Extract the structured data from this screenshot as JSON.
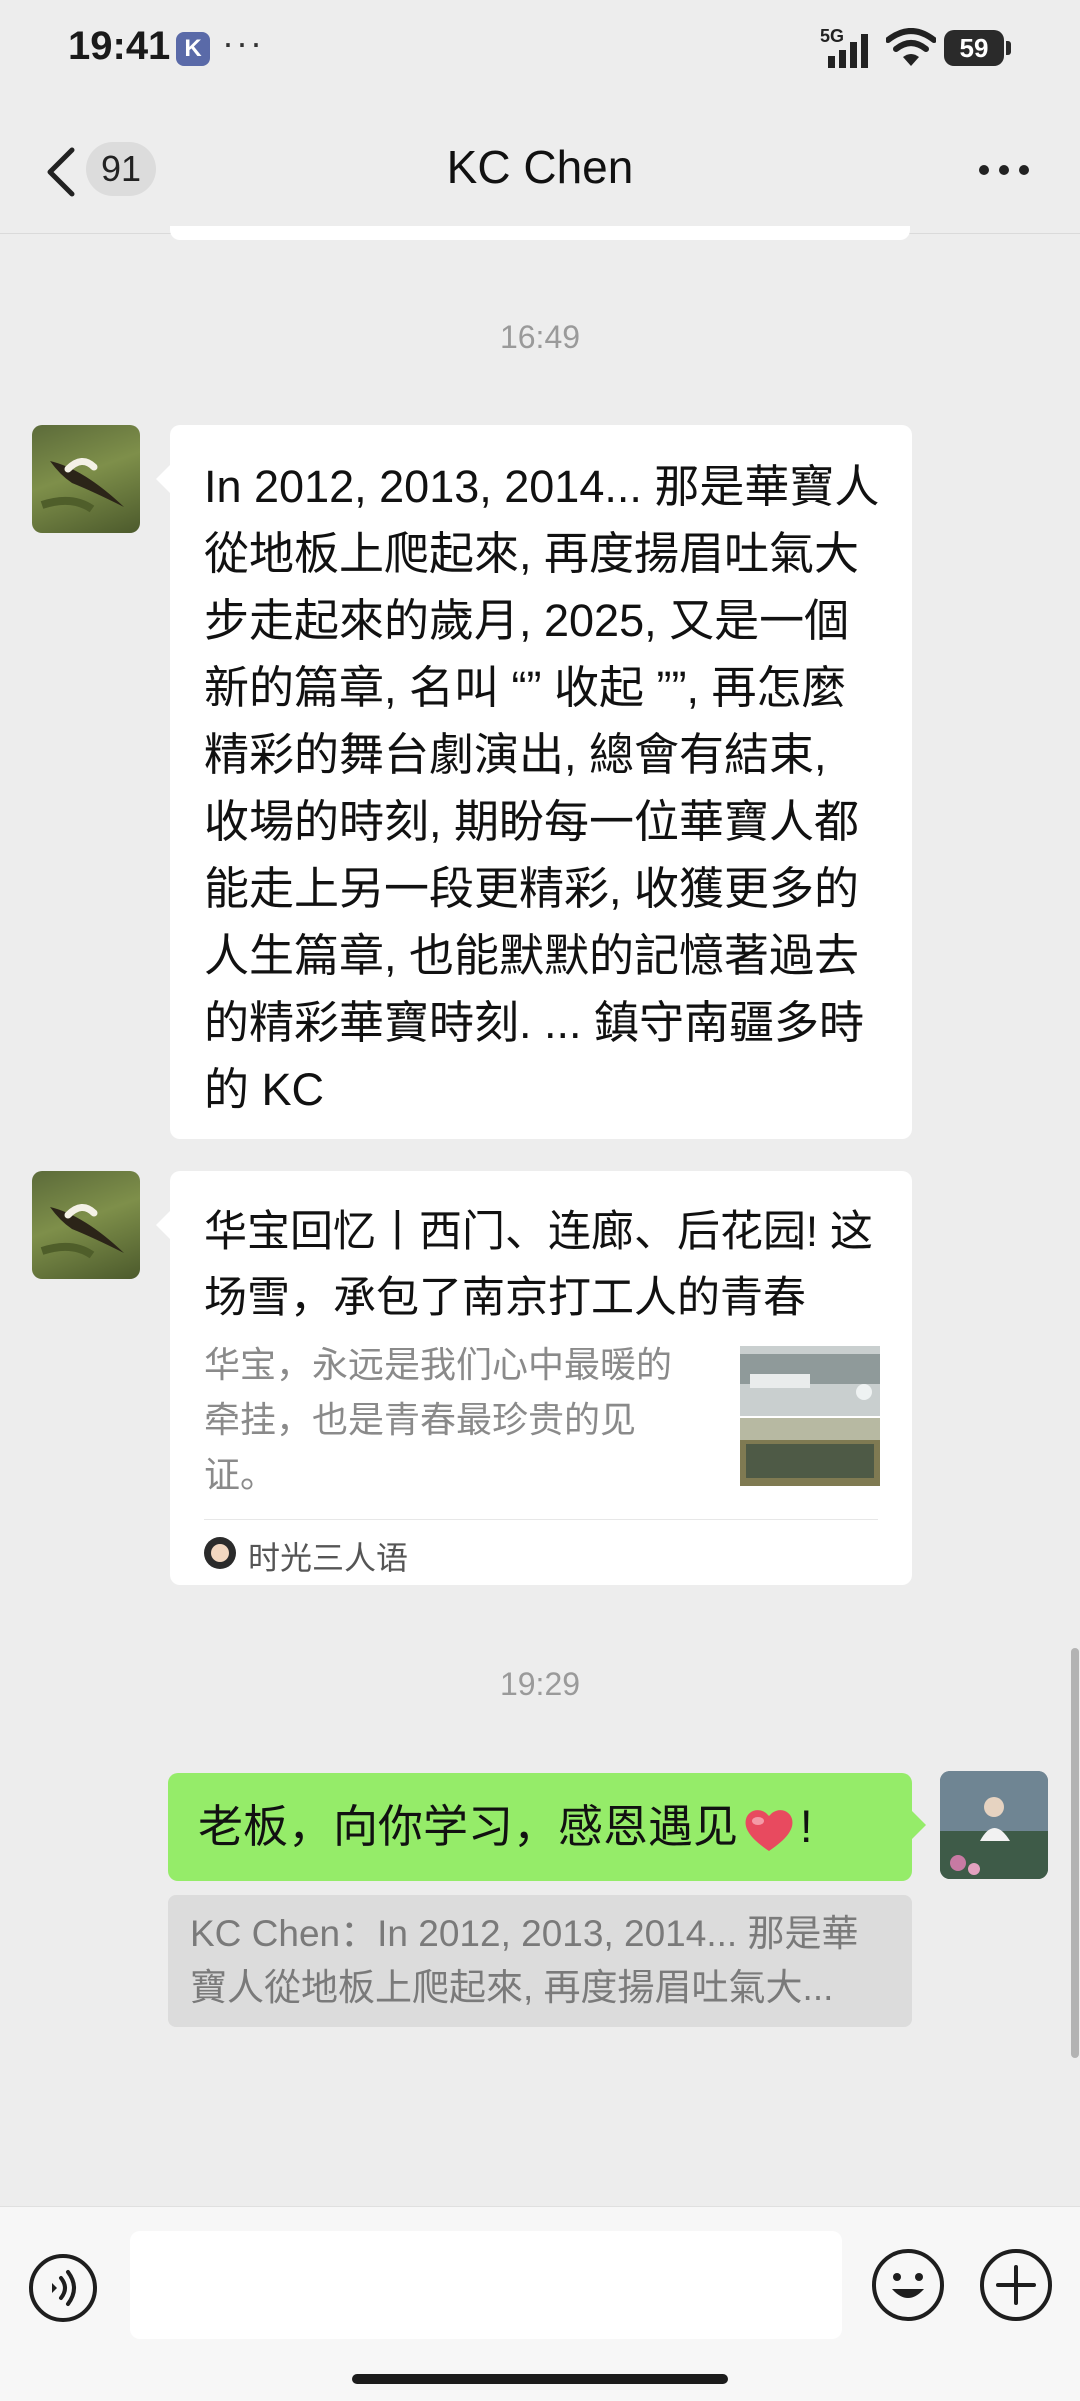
{
  "status_bar": {
    "time": "19:41",
    "app_icon_letter": "K",
    "more": "···",
    "network": "5G",
    "battery": "59"
  },
  "nav": {
    "unread_count": "91",
    "title": "KC Chen"
  },
  "messages": {
    "timestamp_1": "16:49",
    "msg1_text": "In 2012, 2013, 2014... 那是華寶人從地板上爬起來, 再度揚眉吐氣大步走起來的歲月, 2025, 又是一個新的篇章, 名叫 “” 收起 ””, 再怎麼精彩的舞台劇演出, 總會有結束, 收場的時刻, 期盼每一位華寶人都能走上另一段更精彩, 收獲更多的人生篇章, 也能默默的記憶著過去的精彩華寶時刻. ... 鎮守南疆多時的 KC",
    "card": {
      "title": "华宝回忆丨西门、连廊、后花园! 这场雪，承包了南京打工人的青春",
      "description": "华宝，永远是我们心中最暖的牵挂，也是青春最珍贵的见证。",
      "source": "时光三人语"
    },
    "timestamp_2": "19:29",
    "msg2_before": "老板，向你学习，感恩遇见",
    "msg2_after": "!",
    "quote_text": "KC Chen：In 2012, 2013, 2014... 那是華寶人從地板上爬起來, 再度揚眉吐氣大..."
  },
  "colors": {
    "bubble_sent": "#95ec69",
    "background": "#ededed",
    "heart": "#e84a5f"
  },
  "icons": [
    "back-icon",
    "more-icon",
    "voice-icon",
    "emoji-icon",
    "plus-icon",
    "heart-emoji-icon",
    "signal-icon",
    "wifi-icon"
  ]
}
